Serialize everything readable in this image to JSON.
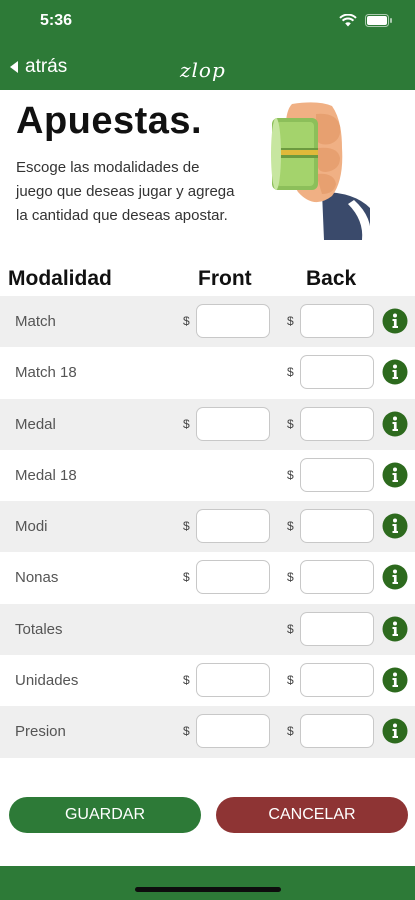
{
  "status": {
    "time": "5:36"
  },
  "nav": {
    "back_label": "atrás",
    "logo_text": "zlop"
  },
  "hero": {
    "title": "Apuestas.",
    "description": "Escoge las modalidades de juego que deseas jugar y agrega la cantidad que deseas apostar."
  },
  "table": {
    "col_modalidad": "Modalidad",
    "col_front": "Front",
    "col_back": "Back",
    "currency": "$",
    "rows": [
      {
        "label": "Match",
        "has_front": true
      },
      {
        "label": "Match 18",
        "has_front": false
      },
      {
        "label": "Medal",
        "has_front": true
      },
      {
        "label": "Medal 18",
        "has_front": false
      },
      {
        "label": "Modi",
        "has_front": true
      },
      {
        "label": "Nonas",
        "has_front": true
      },
      {
        "label": "Totales",
        "has_front": false
      },
      {
        "label": "Unidades",
        "has_front": true
      },
      {
        "label": "Presion",
        "has_front": true
      }
    ]
  },
  "actions": {
    "save_label": "GUARDAR",
    "cancel_label": "CANCELAR"
  },
  "colors": {
    "brand_green": "#2d7a37",
    "cancel_red": "#8e3434",
    "row_shade": "#efefef"
  }
}
